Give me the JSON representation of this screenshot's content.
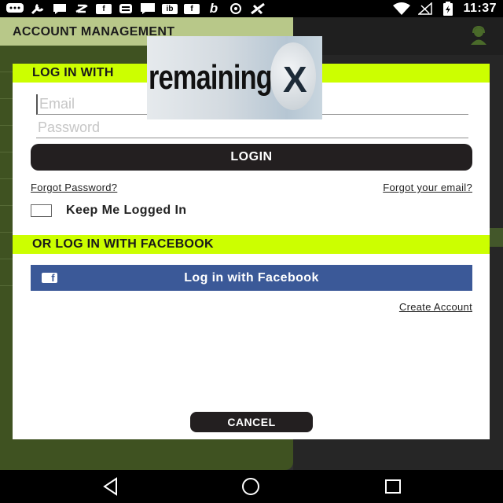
{
  "status_bar": {
    "time": "11:37",
    "icons": [
      "chat-bubble-icon",
      "wrench-icon",
      "messenger-icon",
      "mode-icon",
      "facebook-icon",
      "app-icon",
      "message-icon",
      "ib-icon",
      "facebook-icon",
      "b-icon",
      "sync-icon",
      "satellite-icon",
      "wifi-icon",
      "no-signal-icon",
      "battery-charging-icon"
    ]
  },
  "background_app": {
    "drawer_title": "ACCOUNT MANAGEMENT"
  },
  "dialog": {
    "login_header": "LOG IN WITH",
    "email_placeholder": "Email",
    "password_placeholder": "Password",
    "login_button": "LOGIN",
    "forgot_password": "Forgot Password?",
    "forgot_email": "Forgot your email?",
    "keep_logged_in": "Keep Me Logged In",
    "facebook_header": "OR LOG IN WITH FACEBOOK",
    "facebook_button": "Log in with Facebook",
    "create_account": "Create Account",
    "cancel_button": "CANCEL"
  },
  "ad_overlay": {
    "text": "remaining",
    "close_glyph": "X"
  },
  "colors": {
    "accent": "#ccff00",
    "drawer_bg": "#3f5221",
    "button_dark": "#231f20",
    "facebook_blue": "#3b5998"
  }
}
